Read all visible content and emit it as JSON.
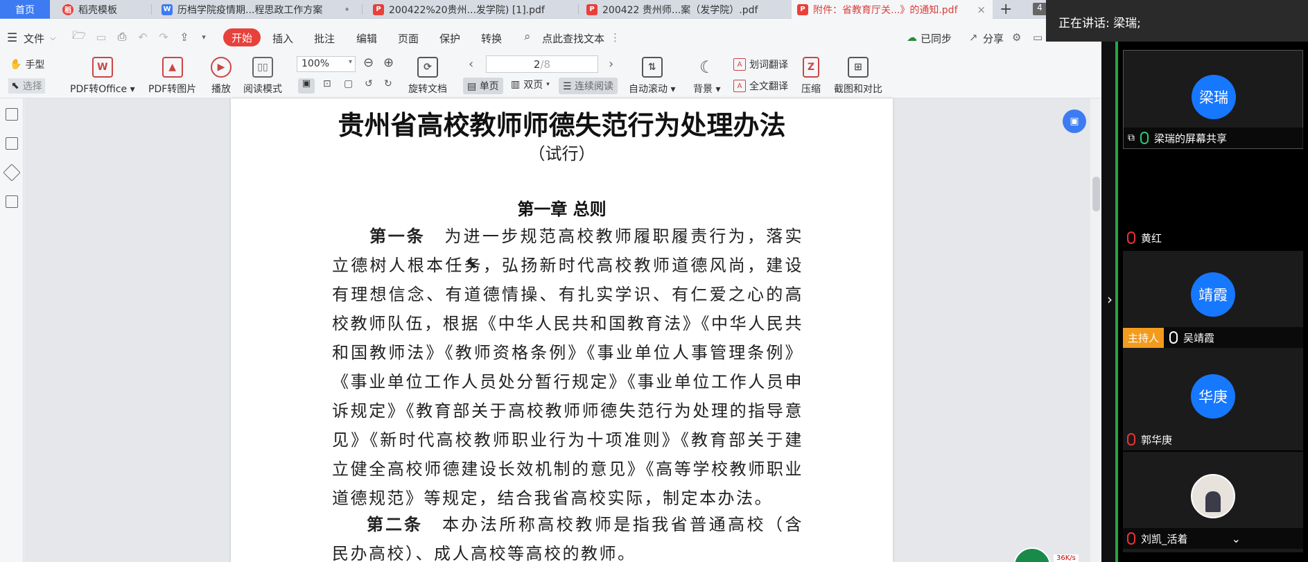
{
  "tabs": [
    {
      "label": "首页",
      "kind": "home"
    },
    {
      "label": "稻壳模板",
      "icon": "docer-icon",
      "color": "#e8403a"
    },
    {
      "label": "历档学院疫情期...程思政工作方案",
      "icon": "word-icon",
      "color": "#3d7bf2",
      "dot": "•"
    },
    {
      "label": "200422%20贵州...发学院) [1].pdf",
      "icon": "pdf-icon",
      "color": "#e8403a"
    },
    {
      "label": "200422 贵州师...案（发学院）.pdf",
      "icon": "pdf-icon",
      "color": "#e8403a"
    },
    {
      "label": "附件：省教育厅关...》的通知.pdf",
      "icon": "pdf-icon",
      "color": "#e8403a",
      "close": "×"
    }
  ],
  "tab_new": "+",
  "tab_count": "4",
  "menu": {
    "file": "文件",
    "start": "开始",
    "items": [
      "插入",
      "批注",
      "编辑",
      "页面",
      "保护",
      "转换"
    ],
    "search": "点此查找文本",
    "synced": "已同步",
    "share": "分享"
  },
  "toolbar": {
    "hand": "手型",
    "select": "选择",
    "pdf_to_office": "PDF转Office",
    "pdf_to_image": "PDF转图片",
    "play": "播放",
    "read_mode": "阅读模式",
    "zoom": "100%",
    "rotate": "旋转文档",
    "page_current": "2",
    "page_total": "/8",
    "single": "单页",
    "double": "双页",
    "continuous": "连续阅读",
    "auto_scroll": "自动滚动",
    "background": "背景",
    "word_translate": "划词翻译",
    "full_translate": "全文翻译",
    "compress": "压缩",
    "screenshot_compare": "截图和对比"
  },
  "document": {
    "title": "贵州省高校教师师德失范行为处理办法",
    "subtitle": "（试行）",
    "chapter": "第一章  总则",
    "article1_head": "第一条",
    "article1_body": "为进一步规范高校教师履职履责行为，落实立德树人根本任务，弘扬新时代高校教师道德风尚，建设有理想信念、有道德情操、有扎实学识、有仁爱之心的高校教师队伍，根据《中华人民共和国教育法》《中华人民共和国教师法》《教师资格条例》《事业单位人事管理条例》《事业单位工作人员处分暂行规定》《事业单位工作人员申诉规定》《教育部关于高校教师师德失范行为处理的指导意见》《新时代高校教师职业行为十项准则》《教育部关于建立健全高校师德建设长效机制的意见》《高等学校教师职业道德规范》等规定，结合我省高校实际，制定本办法。",
    "article2_head": "第二条",
    "article2_body": "本办法所称高校教师是指我省普通高校（含民办高校）、成人高校等高校的教师。"
  },
  "meeting": {
    "speaking": "正在讲话: 梁瑞;",
    "participants": [
      {
        "avatar": "梁瑞",
        "name": "梁瑞的屏幕共享",
        "mic": "on",
        "share": true
      },
      {
        "avatar": "",
        "name": "黄红",
        "mic": "off"
      },
      {
        "avatar": "靖霞",
        "name": "吴靖霞",
        "mic": "on",
        "host": "主持人"
      },
      {
        "avatar": "华庚",
        "name": "郭华庚",
        "mic": "off"
      },
      {
        "avatar": "",
        "name": "刘凯_活着",
        "mic": "off",
        "photo": true
      }
    ],
    "netspeed": "36K/s"
  }
}
